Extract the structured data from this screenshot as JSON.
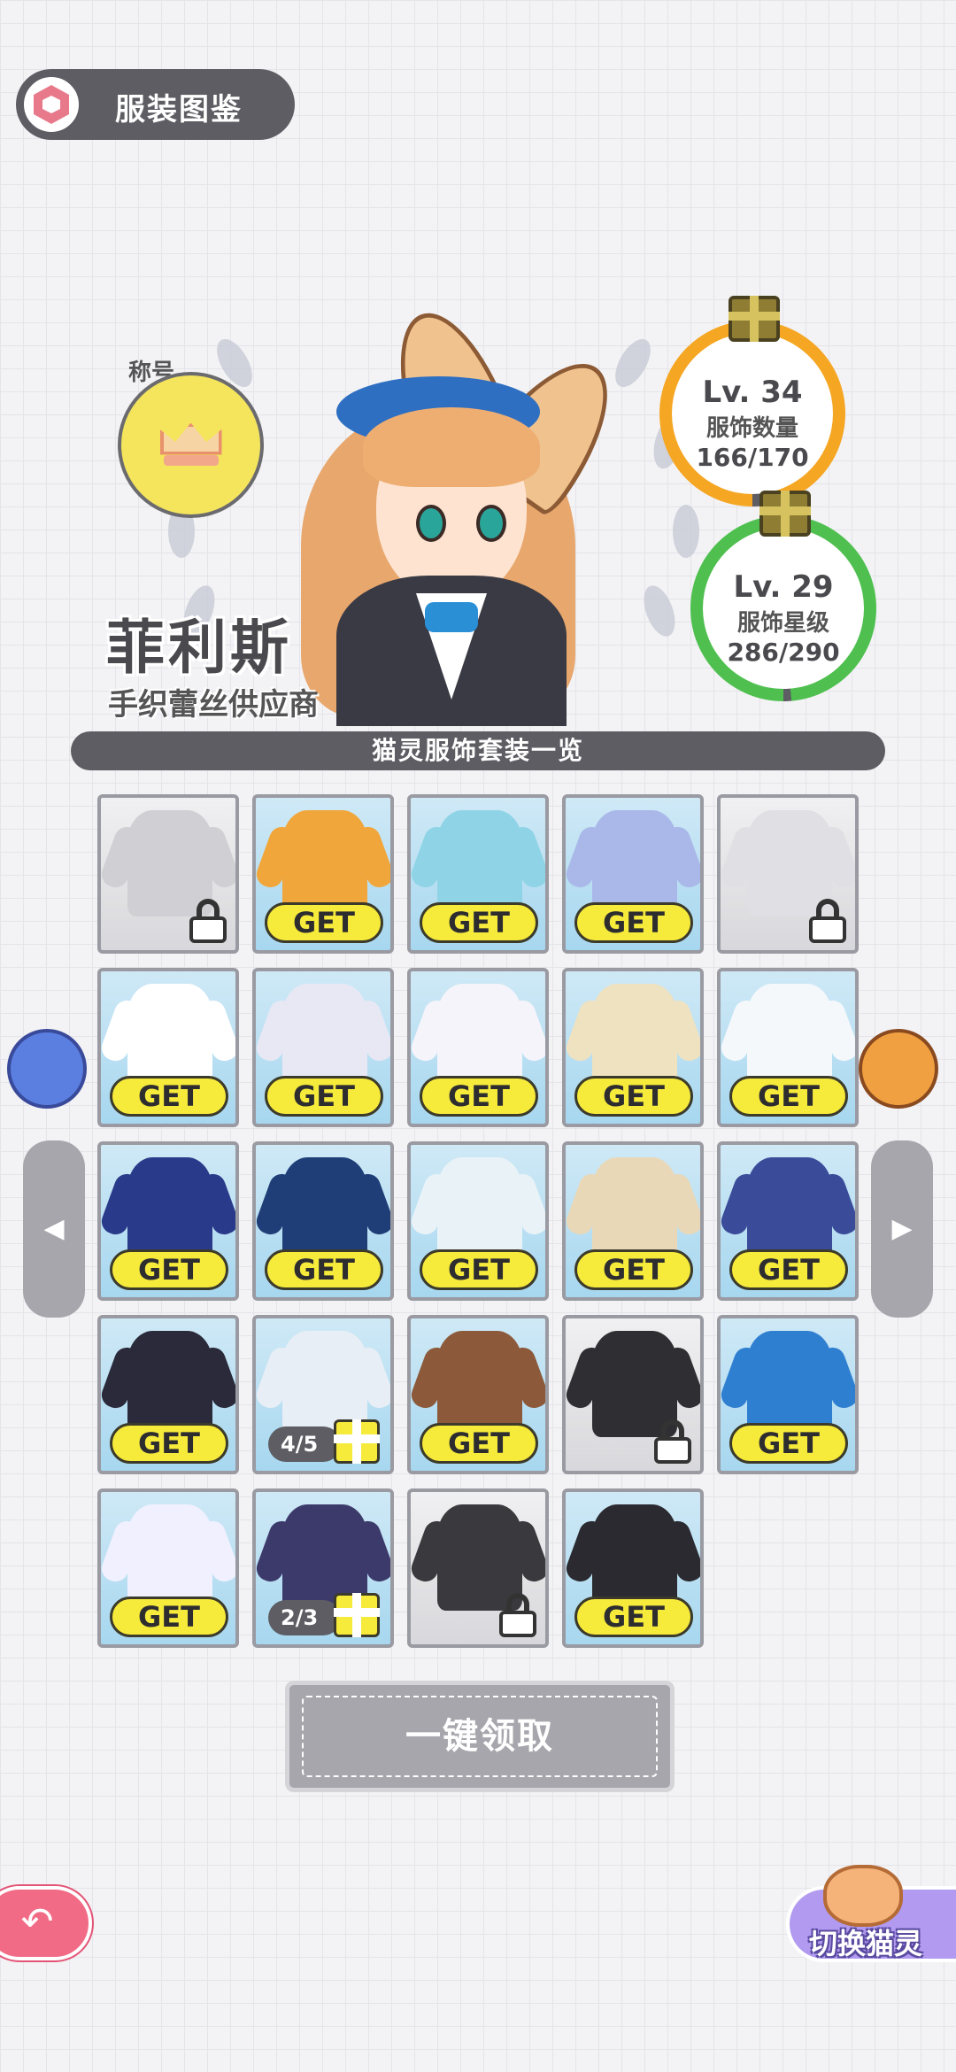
{
  "header": {
    "title": "服装图鉴"
  },
  "title_badge": {
    "label": "称号"
  },
  "character": {
    "name": "菲利斯",
    "subtitle": "手织蕾丝供应商"
  },
  "stats": [
    {
      "level": "Lv. 34",
      "label": "服饰数量",
      "value": "166/170",
      "progress": 0.976,
      "color": "#f5a623"
    },
    {
      "level": "Lv. 29",
      "label": "服饰星级",
      "value": "286/290",
      "progress": 0.986,
      "color": "#4fc04f"
    }
  ],
  "section_title": "猫灵服饰套装一览",
  "outfits": [
    {
      "state": "locked",
      "color": "#d0d0d4"
    },
    {
      "state": "get",
      "label": "GET",
      "color": "#f0a63a"
    },
    {
      "state": "get",
      "label": "GET",
      "color": "#8fd4e6"
    },
    {
      "state": "get",
      "label": "GET",
      "color": "#a9b8e8"
    },
    {
      "state": "locked",
      "color": "#e0e0e4"
    },
    {
      "state": "get",
      "label": "GET",
      "color": "#ffffff"
    },
    {
      "state": "get",
      "label": "GET",
      "color": "#e8e8f5"
    },
    {
      "state": "get",
      "label": "GET",
      "color": "#f4f4fa"
    },
    {
      "state": "get",
      "label": "GET",
      "color": "#efe2c0"
    },
    {
      "state": "get",
      "label": "GET",
      "color": "#f4f8fb"
    },
    {
      "state": "get",
      "label": "GET",
      "color": "#2a3a8a"
    },
    {
      "state": "get",
      "label": "GET",
      "color": "#1f3e78"
    },
    {
      "state": "get",
      "label": "GET",
      "color": "#e9f3f7"
    },
    {
      "state": "get",
      "label": "GET",
      "color": "#e9d8b8"
    },
    {
      "state": "get",
      "label": "GET",
      "color": "#3a4b9a"
    },
    {
      "state": "get",
      "label": "GET",
      "color": "#2a2a3a"
    },
    {
      "state": "progress",
      "progress_text": "4/5",
      "color": "#e8eef5"
    },
    {
      "state": "get",
      "label": "GET",
      "color": "#8c5a3a"
    },
    {
      "state": "locked",
      "color": "#2f2f33"
    },
    {
      "state": "get",
      "label": "GET",
      "color": "#2f7fd1"
    },
    {
      "state": "get",
      "label": "GET",
      "color": "#f0f0ff"
    },
    {
      "state": "progress",
      "progress_text": "2/3",
      "color": "#3c3a6a"
    },
    {
      "state": "locked",
      "color": "#3a3a3e"
    },
    {
      "state": "get",
      "label": "GET",
      "color": "#2a2a30"
    }
  ],
  "collect_all": "一键领取",
  "switch_label": "切换猫灵",
  "icons": {
    "back": "back-arrow-icon",
    "prev": "left-arrow-icon",
    "next": "right-arrow-icon",
    "lock": "lock-icon",
    "gift": "gift-icon",
    "crown": "crown-icon"
  }
}
